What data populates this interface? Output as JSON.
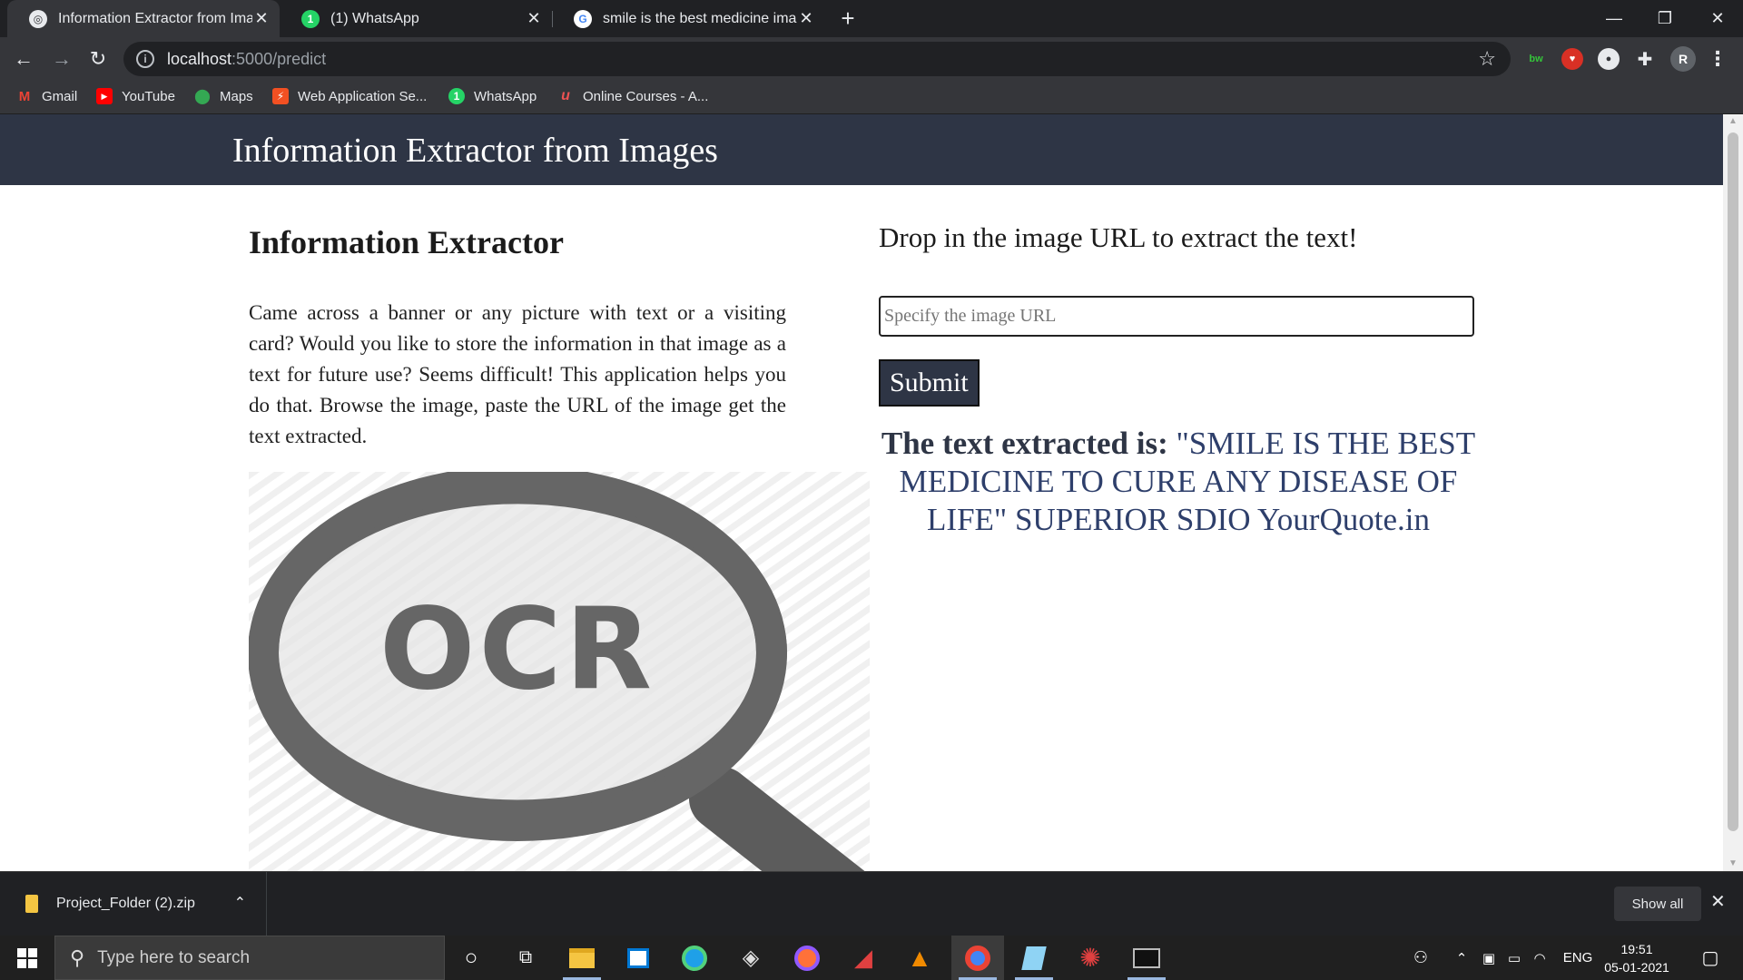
{
  "browser": {
    "tabs": [
      {
        "title": "Information Extractor from Image",
        "active": true,
        "favicon": "globe-icon"
      },
      {
        "title": "(1) WhatsApp",
        "active": false,
        "favicon": "whatsapp-icon"
      },
      {
        "title": "smile is the best medicine image",
        "active": false,
        "favicon": "google-icon"
      }
    ],
    "address": {
      "host": "localhost",
      "path": ":5000/predict"
    },
    "profile_initial": "R",
    "bookmarks": [
      {
        "label": "Gmail",
        "icon": "gmail-icon"
      },
      {
        "label": "YouTube",
        "icon": "youtube-icon"
      },
      {
        "label": "Maps",
        "icon": "maps-icon"
      },
      {
        "label": "Web Application Se...",
        "icon": "bolt-icon"
      },
      {
        "label": "WhatsApp",
        "icon": "whatsapp-icon"
      },
      {
        "label": "Online Courses - A...",
        "icon": "udemy-icon"
      }
    ]
  },
  "page": {
    "header_title": "Information Extractor from Images",
    "left_heading": "Information Extractor",
    "description": "Came across a banner or any picture with text or a visiting card? Would you like to store the information in that image as a text for future use? Seems difficult! This application helps you do that. Browse the image, paste the URL of the image get the text extracted.",
    "image_text": "OCR",
    "prompt": "Drop in the image URL to extract the text!",
    "input_placeholder": "Specify the image URL",
    "input_value": "",
    "submit_label": "Submit",
    "result_label": "The text extracted is:",
    "result_text": "\"SMILE IS THE BEST MEDICINE TO CURE ANY DISEASE OF LIFE\" SUPERIOR SDIO YourQuote.in"
  },
  "downloads": {
    "file_name": "Project_Folder (2).zip",
    "show_all_label": "Show all"
  },
  "taskbar": {
    "search_placeholder": "Type here to search",
    "language": "ENG",
    "time": "19:51",
    "date": "05-01-2021"
  },
  "colors": {
    "header_bg": "#2e3545",
    "result_text": "#2e3f6b",
    "chrome_dark": "#202124"
  }
}
